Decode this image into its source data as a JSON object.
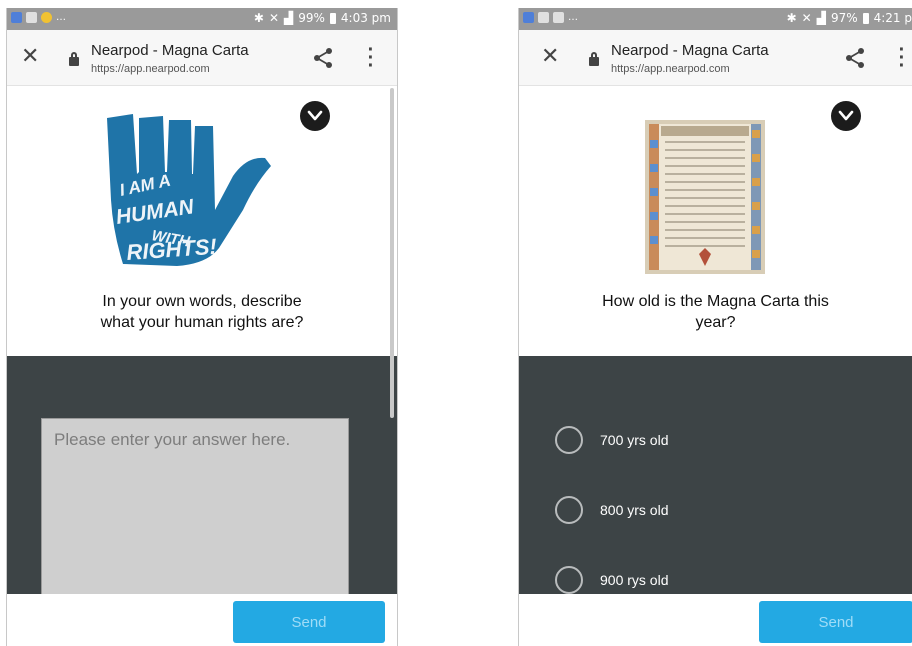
{
  "left_screen": {
    "status_bar": {
      "battery": "99%",
      "time": "4:03 pm"
    },
    "browser": {
      "title": "Nearpod - Magna Carta",
      "url": "https://app.nearpod.com"
    },
    "image_text": [
      "I AM A",
      "HUMAN",
      "WITH",
      "RIGHTS!"
    ],
    "question_lines": [
      "In your own words, describe",
      "what your human rights are?"
    ],
    "answer": {
      "value": "",
      "placeholder": "Please enter your answer here."
    },
    "send_label": "Send"
  },
  "right_screen": {
    "status_bar": {
      "battery": "97%",
      "time": "4:21 p"
    },
    "browser": {
      "title": "Nearpod - Magna Carta",
      "url": "https://app.nearpod.com"
    },
    "question_lines": [
      "How old is the Magna Carta this",
      "year?"
    ],
    "options": [
      {
        "label": "700 yrs old"
      },
      {
        "label": "800 yrs old"
      },
      {
        "label": "900 rys old"
      }
    ],
    "send_label": "Send"
  },
  "colors": {
    "accent": "#23a9e3",
    "dark_panel": "#3d4446",
    "hand_blue": "#1f74a8",
    "status_bar": "#9a9a9a"
  },
  "icons": {
    "close": "close-icon",
    "lock": "lock-icon",
    "share": "share-icon",
    "menu": "more-vert-icon",
    "collapse": "chevron-down-icon",
    "radio": "radio-unchecked-icon"
  }
}
